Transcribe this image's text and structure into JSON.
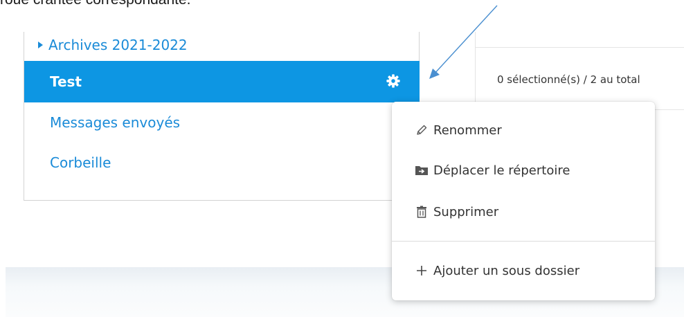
{
  "caption": "roue crantée correspondante.",
  "sidebar": {
    "folders": [
      {
        "label": "Archives 2021-2022"
      },
      {
        "label": "Test"
      },
      {
        "label": "Messages envoyés"
      },
      {
        "label": "Corbeille"
      }
    ]
  },
  "main": {
    "selection_count": "0 sélectionné(s) / 2 au total"
  },
  "context_menu": {
    "items": [
      {
        "label": "Renommer",
        "icon": "pencil-icon"
      },
      {
        "label": "Déplacer le répertoire",
        "icon": "folder-move-icon"
      },
      {
        "label": "Supprimer",
        "icon": "trash-icon"
      },
      {
        "label": "Ajouter un sous dossier",
        "icon": "plus-icon"
      }
    ]
  },
  "colors": {
    "accent": "#0d96e3",
    "link": "#1a8bd8",
    "arrow": "#4a8fd0"
  }
}
